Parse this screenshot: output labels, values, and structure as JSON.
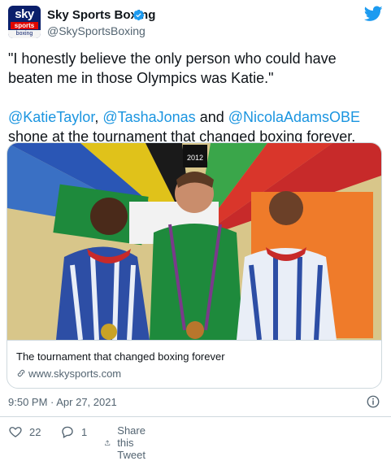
{
  "account": {
    "avatar_sky": "sky",
    "avatar_sports": "sports",
    "avatar_boxing": "boxing",
    "name": "Sky Sports Boxing",
    "handle": "@SkySportsBoxing"
  },
  "tweet": {
    "quote": "\"I honestly believe the only person who could have beaten me in those Olympics was Katie.\"",
    "mention1": "@KatieTaylor",
    "sep1": ", ",
    "mention2": "@TashaJonas",
    "and": " and ",
    "mention3": "@NicolaAdamsOBE",
    "line_end": "shone at the tournament that changed boxing forever."
  },
  "card": {
    "title": "The tournament that changed boxing forever",
    "domain": "www.skysports.com"
  },
  "meta": {
    "timestamp": "9:50 PM · Apr 27, 2021"
  },
  "actions": {
    "likes": "22",
    "replies": "1",
    "share_label": "Share this Tweet"
  },
  "colors": {
    "mention": "#1b95e0",
    "twitter_blue": "#1d9bf0",
    "secondary_text": "#536471",
    "like_icon": "#e0245e"
  },
  "icons": [
    "verified-badge-icon",
    "twitter-bird-icon",
    "link-icon",
    "info-icon",
    "heart-icon",
    "reply-icon",
    "share-icon"
  ]
}
